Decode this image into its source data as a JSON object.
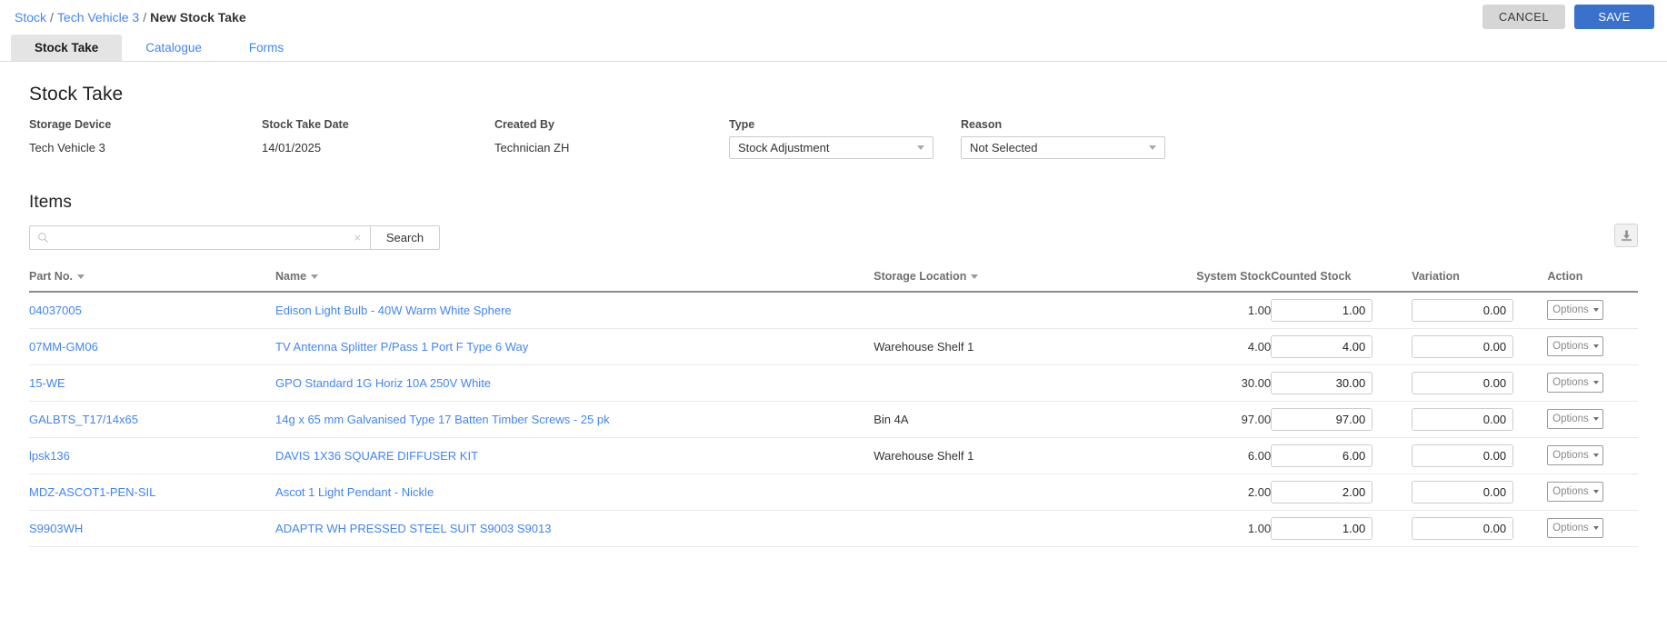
{
  "breadcrumb": {
    "root": "Stock",
    "parent": "Tech Vehicle 3",
    "current": "New Stock Take",
    "separator": "/"
  },
  "topbar": {
    "cancel_label": "CANCEL",
    "save_label": "SAVE"
  },
  "tabs": [
    {
      "label": "Stock Take",
      "active": true
    },
    {
      "label": "Catalogue",
      "active": false
    },
    {
      "label": "Forms",
      "active": false
    }
  ],
  "page": {
    "title": "Stock Take",
    "items_title": "Items"
  },
  "meta": {
    "storage_device": {
      "label": "Storage Device",
      "value": "Tech Vehicle 3"
    },
    "stock_take_date": {
      "label": "Stock Take Date",
      "value": "14/01/2025"
    },
    "created_by": {
      "label": "Created By",
      "value": "Technician ZH"
    },
    "type": {
      "label": "Type",
      "value": "Stock Adjustment"
    },
    "reason": {
      "label": "Reason",
      "value": "Not Selected"
    }
  },
  "search": {
    "value": "",
    "placeholder": "",
    "clear_label": "×",
    "button_label": "Search"
  },
  "table": {
    "columns": {
      "part_no": "Part No.",
      "name": "Name",
      "storage_location": "Storage Location",
      "system_stock": "System Stock",
      "counted_stock": "Counted Stock",
      "variation": "Variation",
      "action": "Action"
    },
    "options_label": "Options",
    "rows": [
      {
        "part_no": "04037005",
        "name": "Edison Light Bulb - 40W Warm White Sphere",
        "storage_location": "",
        "system_stock": "1.00",
        "counted_stock": "1.00",
        "variation": "0.00"
      },
      {
        "part_no": "07MM-GM06",
        "name": "TV Antenna Splitter P/Pass 1 Port F Type 6 Way",
        "storage_location": "Warehouse Shelf 1",
        "system_stock": "4.00",
        "counted_stock": "4.00",
        "variation": "0.00"
      },
      {
        "part_no": "15-WE",
        "name": "GPO Standard 1G Horiz 10A 250V White",
        "storage_location": "",
        "system_stock": "30.00",
        "counted_stock": "30.00",
        "variation": "0.00"
      },
      {
        "part_no": "GALBTS_T17/14x65",
        "name": "14g x 65 mm Galvanised Type 17 Batten Timber Screws - 25 pk",
        "storage_location": "Bin 4A",
        "system_stock": "97.00",
        "counted_stock": "97.00",
        "variation": "0.00"
      },
      {
        "part_no": "lpsk136",
        "name": "DAVIS 1X36 SQUARE DIFFUSER KIT",
        "storage_location": "Warehouse Shelf 1",
        "system_stock": "6.00",
        "counted_stock": "6.00",
        "variation": "0.00"
      },
      {
        "part_no": "MDZ-ASCOT1-PEN-SIL",
        "name": "Ascot 1 Light Pendant - Nickle",
        "storage_location": "",
        "system_stock": "2.00",
        "counted_stock": "2.00",
        "variation": "0.00"
      },
      {
        "part_no": "S9903WH",
        "name": "ADAPTR WH PRESSED STEEL SUIT S9003 S9013",
        "storage_location": "",
        "system_stock": "1.00",
        "counted_stock": "1.00",
        "variation": "0.00"
      }
    ]
  },
  "icons": {
    "search": "search-icon",
    "export": "download-icon",
    "clear": "close-icon",
    "sort": "chevron-down-icon"
  },
  "colors": {
    "link": "#4285f4",
    "save_button": "#3a71cc",
    "cancel_button": "#d6d6d6",
    "active_tab_bg": "#e4e4e4"
  }
}
